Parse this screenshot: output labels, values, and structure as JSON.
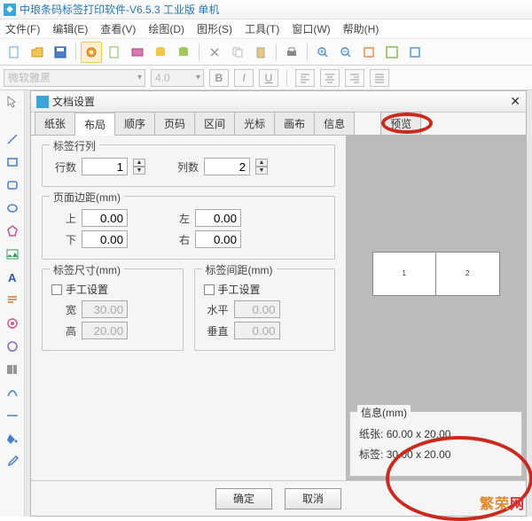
{
  "app": {
    "title": "中琅条码标签打印软件-V6.5.3 工业版 单机"
  },
  "menu": {
    "file": "文件(F)",
    "edit": "编辑(E)",
    "view": "查看(V)",
    "draw": "绘图(D)",
    "shape": "图形(S)",
    "tool": "工具(T)",
    "window": "窗口(W)",
    "help": "帮助(H)"
  },
  "fontbar": {
    "font": "微软雅黑",
    "size": "4.0"
  },
  "dialog": {
    "title": "文档设置",
    "tabs": {
      "paper": "纸张",
      "layout": "布局",
      "order": "顺序",
      "pagenum": "页码",
      "section": "区间",
      "cursor": "光标",
      "canvas": "画布",
      "info": "信息",
      "preview": "预览"
    },
    "rowscols": {
      "title": "标签行列",
      "rows_lbl": "行数",
      "rows": "1",
      "cols_lbl": "列数",
      "cols": "2"
    },
    "margins": {
      "title": "页面边距(mm)",
      "top_lbl": "上",
      "top": "0.00",
      "left_lbl": "左",
      "left": "0.00",
      "bottom_lbl": "下",
      "bottom": "0.00",
      "right_lbl": "右",
      "right": "0.00"
    },
    "size": {
      "title": "标签尺寸(mm)",
      "manual": "手工设置",
      "w_lbl": "宽",
      "w": "30.00",
      "h_lbl": "高",
      "h": "20.00"
    },
    "gap": {
      "title": "标签间距(mm)",
      "manual": "手工设置",
      "hz_lbl": "水平",
      "hz": "0.00",
      "vt_lbl": "垂直",
      "vt": "0.00"
    },
    "infobox": {
      "title": "信息(mm)",
      "paper_lbl": "纸张:",
      "paper": "60.00 x 20.00",
      "label_lbl": "标签:",
      "label": "30.00 x 20.00"
    },
    "buttons": {
      "ok": "确定",
      "cancel": "取消"
    }
  },
  "watermark": {
    "a": "繁荣",
    "b": "网"
  }
}
